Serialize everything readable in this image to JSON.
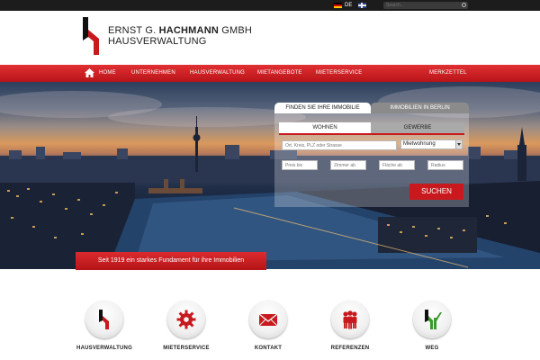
{
  "topbar": {
    "languages": [
      "DE"
    ],
    "search_placeholder": "Search..."
  },
  "header": {
    "brand_line1_pre": "ERNST G. ",
    "brand_line1_bold": "HACHMANN",
    "brand_line1_post": " GMBH",
    "brand_line2": "HAUSVERWALTUNG"
  },
  "nav": {
    "items": [
      "HOME",
      "UNTERNEHMEN",
      "HAUSVERWALTUNG",
      "MIETANGEBOTE",
      "MIETERSERVICE"
    ],
    "right": "MERKZETTEL"
  },
  "search_panel": {
    "tab_active": "FINDEN SIE IHRE IMMOBILIE",
    "tab_inactive": "IMMOBILIEN IN BERLIN",
    "subtab_active": "WOHNEN",
    "subtab_inactive": "GEWERBE",
    "location_placeholder": "Ort, Kreis, PLZ oder Strasse",
    "type_selected": "Mietwohnung",
    "price_placeholder": "Preis bis",
    "rooms_placeholder": "Zimmer ab",
    "area_placeholder": "Fläche ab",
    "radius_placeholder": "Radius",
    "submit": "SUCHEN"
  },
  "banner": "Seit 1919 ein starkes Fundament für ihre Immobilien",
  "features": [
    {
      "label": "HAUSVERWALTUNG",
      "icon": "logo-mark-icon"
    },
    {
      "label": "MIETERSERVICE",
      "icon": "gear-icon"
    },
    {
      "label": "KONTAKT",
      "icon": "envelope-icon"
    },
    {
      "label": "REFERENZEN",
      "icon": "people-icon"
    },
    {
      "label": "WEG",
      "icon": "weg-logo-icon"
    }
  ],
  "colors": {
    "brand_red": "#c81a1e",
    "dark": "#1c1c1c",
    "green": "#3b9a2e"
  }
}
